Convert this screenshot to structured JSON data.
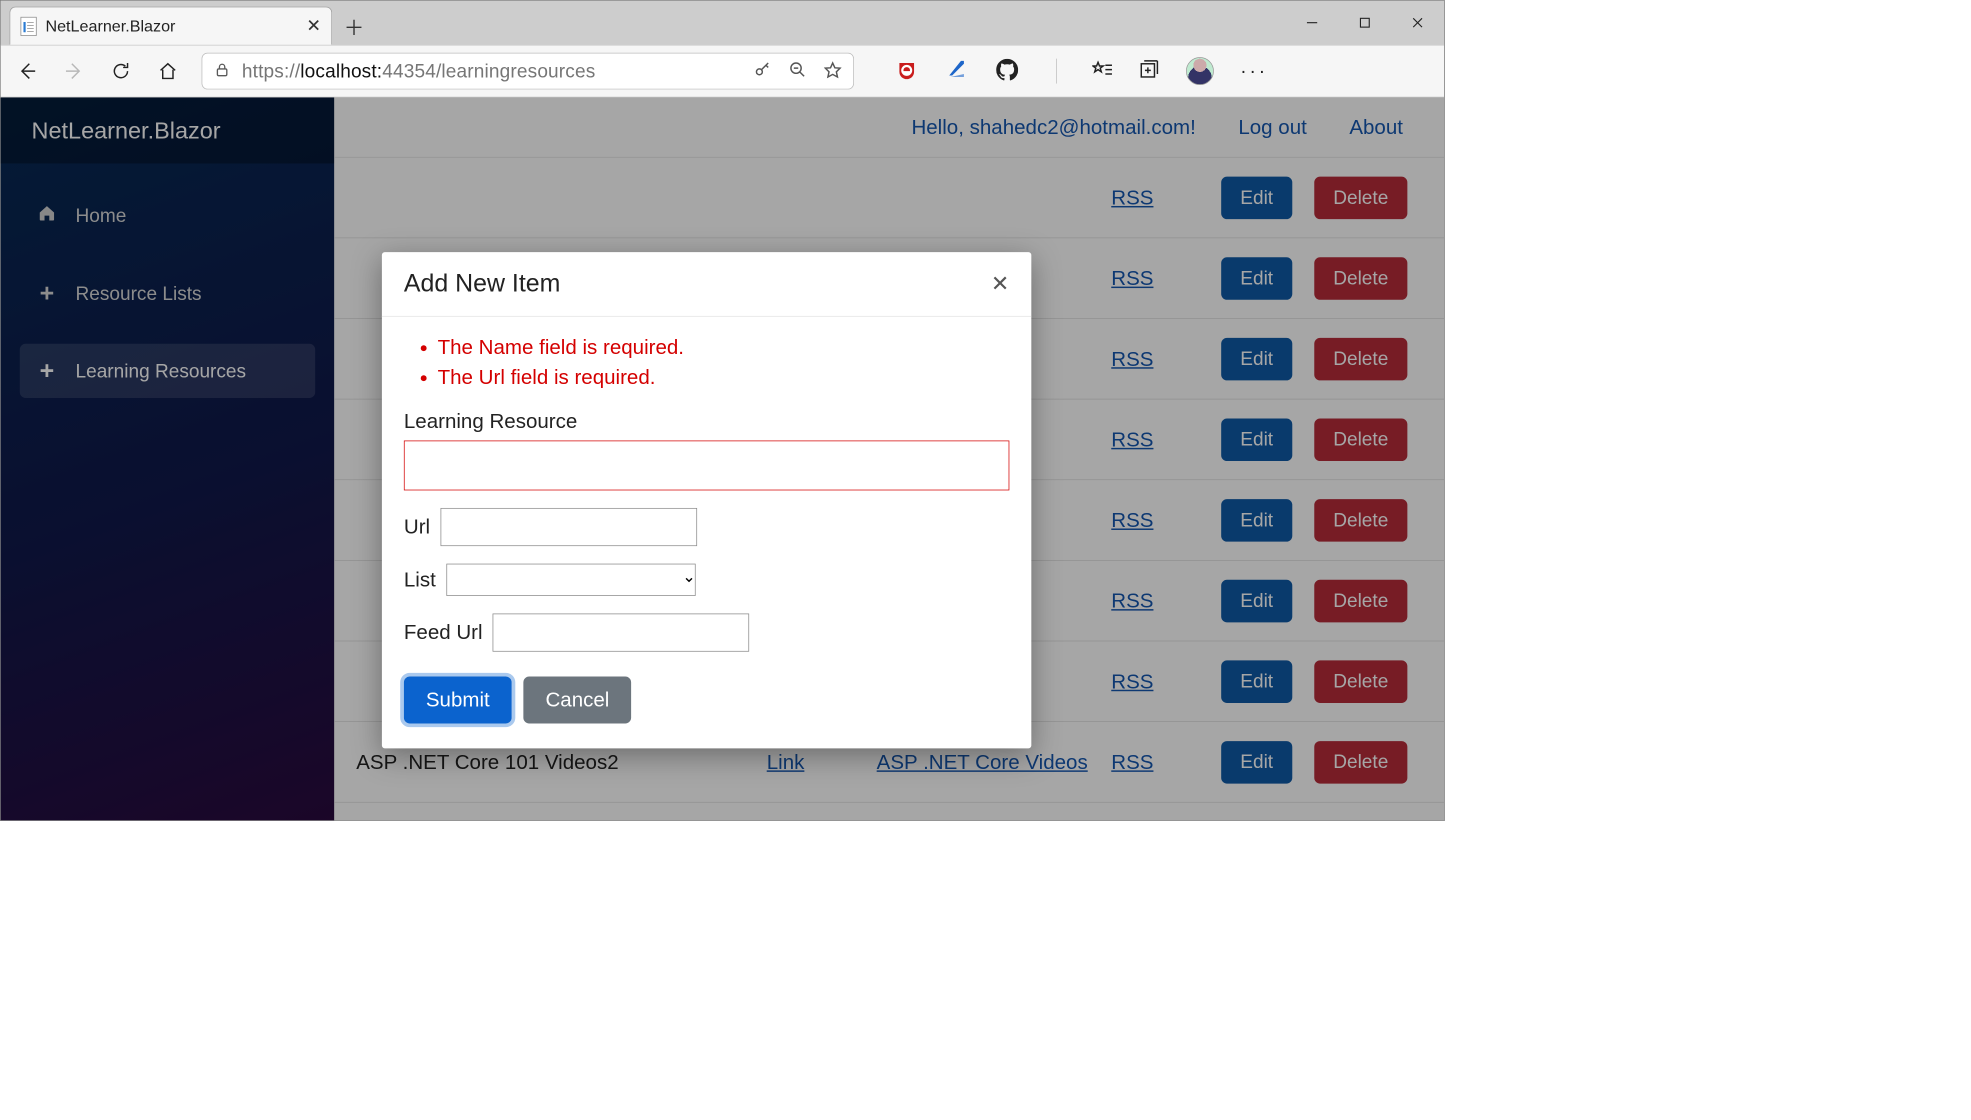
{
  "browser": {
    "tab_title": "NetLearner.Blazor",
    "url_proto": "https://",
    "url_host": "localhost:",
    "url_port_path": "44354/learningresources"
  },
  "sidebar": {
    "brand": "NetLearner.Blazor",
    "items": [
      {
        "icon": "home",
        "label": "Home"
      },
      {
        "icon": "plus",
        "label": "Resource Lists"
      },
      {
        "icon": "plus",
        "label": "Learning Resources"
      }
    ]
  },
  "topbar": {
    "greeting": "Hello, shahedc2@hotmail.com!",
    "logout": "Log out",
    "about": "About"
  },
  "table": {
    "edit_label": "Edit",
    "delete_label": "Delete",
    "rows": [
      {
        "name": "",
        "type": "",
        "list": "",
        "rss": "RSS"
      },
      {
        "name": "",
        "type": "",
        "list": "",
        "rss": "RSS"
      },
      {
        "name": "",
        "type": "",
        "list": "",
        "rss": "RSS"
      },
      {
        "name": "",
        "type": "",
        "list": "",
        "rss": "RSS"
      },
      {
        "name": "",
        "type": "",
        "list": "",
        "rss": "RSS"
      },
      {
        "name": "",
        "type": "",
        "list": "",
        "rss": "RSS"
      },
      {
        "name": "",
        "type": "",
        "list": "",
        "rss": "RSS"
      },
      {
        "name": "ASP .NET Core 101 Videos2",
        "type": "Link",
        "list": "ASP .NET Core Videos",
        "rss": "RSS"
      }
    ]
  },
  "modal": {
    "title": "Add New Item",
    "errors": [
      "The Name field is required.",
      "The Url field is required."
    ],
    "labels": {
      "name": "Learning Resource",
      "url": "Url",
      "list": "List",
      "feed": "Feed Url"
    },
    "values": {
      "name": "",
      "url": "",
      "list": "",
      "feed": ""
    },
    "buttons": {
      "submit": "Submit",
      "cancel": "Cancel"
    }
  }
}
